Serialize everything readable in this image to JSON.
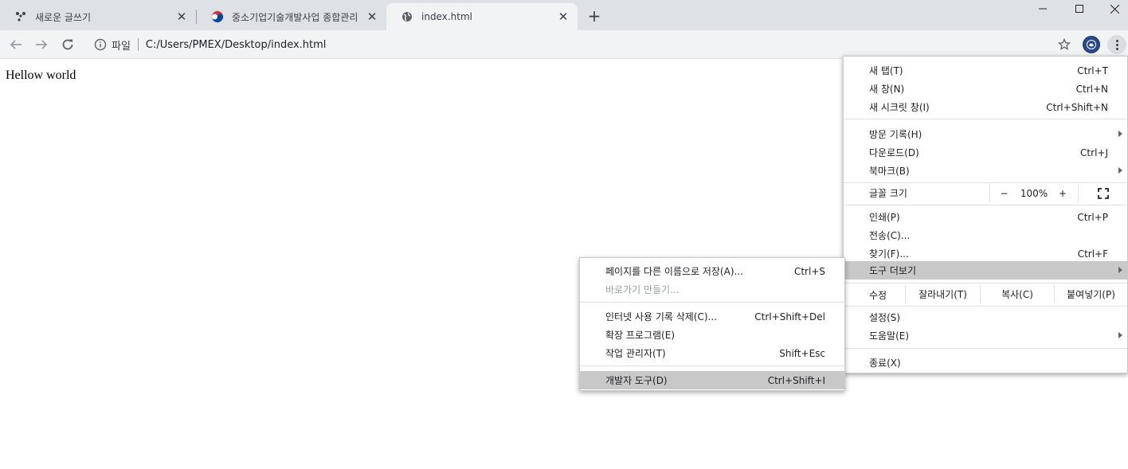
{
  "tabs": [
    {
      "title": "새로운 글쓰기",
      "icon": "dots-icon"
    },
    {
      "title": "중소기업기술개발사업 종합관리",
      "icon": "korea-emblem-icon"
    },
    {
      "title": "index.html",
      "icon": "globe-icon",
      "active": true
    }
  ],
  "omnibox": {
    "scheme": "파일",
    "url": "C:/Users/PMEX/Desktop/index.html"
  },
  "page": {
    "text": "Hellow world"
  },
  "main_menu": {
    "new_tab": {
      "label": "새 탭(T)",
      "shortcut": "Ctrl+T"
    },
    "new_window": {
      "label": "새 창(N)",
      "shortcut": "Ctrl+N"
    },
    "new_incognito": {
      "label": "새 시크릿 창(I)",
      "shortcut": "Ctrl+Shift+N"
    },
    "history": {
      "label": "방문 기록(H)"
    },
    "downloads": {
      "label": "다운로드(D)",
      "shortcut": "Ctrl+J"
    },
    "bookmarks": {
      "label": "북마크(B)"
    },
    "zoom": {
      "label": "글꼴 크기",
      "minus": "−",
      "value": "100%",
      "plus": "+"
    },
    "print": {
      "label": "인쇄(P)",
      "shortcut": "Ctrl+P"
    },
    "cast": {
      "label": "전송(C)..."
    },
    "find": {
      "label": "찾기(F)...",
      "shortcut": "Ctrl+F"
    },
    "more_tools": {
      "label": "도구 더보기"
    },
    "edit": {
      "label": "수정",
      "cut": "잘라내기(T)",
      "copy": "복사(C)",
      "paste": "붙여넣기(P)"
    },
    "settings": {
      "label": "설정(S)"
    },
    "help": {
      "label": "도움말(E)"
    },
    "exit": {
      "label": "종료(X)"
    }
  },
  "sub_menu": {
    "save_as": {
      "label": "페이지를 다른 이름으로 저장(A)...",
      "shortcut": "Ctrl+S"
    },
    "create_shortcut": {
      "label": "바로가기 만들기..."
    },
    "clear_data": {
      "label": "인터넷 사용 기록 삭제(C)...",
      "shortcut": "Ctrl+Shift+Del"
    },
    "extensions": {
      "label": "확장 프로그램(E)"
    },
    "task_manager": {
      "label": "작업 관리자(T)",
      "shortcut": "Shift+Esc"
    },
    "devtools": {
      "label": "개발자 도구(D)",
      "shortcut": "Ctrl+Shift+I"
    }
  },
  "colors": {
    "tabstrip": "#dee1e6",
    "toolbar": "#f1f3f4",
    "highlight": "#c8c8c8",
    "avatar": "#2b4a8b"
  }
}
